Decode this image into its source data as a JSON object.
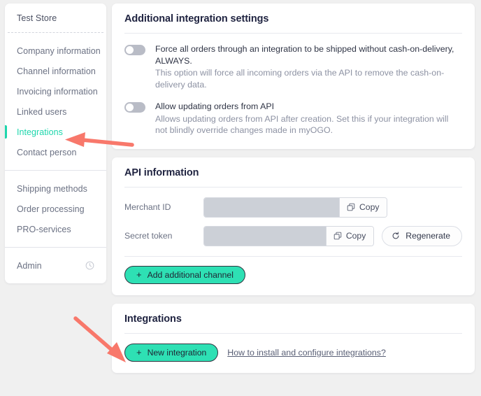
{
  "sidebar": {
    "store_name": "Test Store",
    "groups": [
      {
        "items": [
          {
            "label": "Company information",
            "active": false
          },
          {
            "label": "Channel information",
            "active": false
          },
          {
            "label": "Invoicing information",
            "active": false
          },
          {
            "label": "Linked users",
            "active": false
          },
          {
            "label": "Integrations",
            "active": true
          },
          {
            "label": "Contact person",
            "active": false
          }
        ]
      },
      {
        "items": [
          {
            "label": "Shipping methods",
            "active": false
          },
          {
            "label": "Order processing",
            "active": false
          },
          {
            "label": "PRO-services",
            "active": false
          }
        ]
      },
      {
        "items": [
          {
            "label": "Admin",
            "active": false,
            "icon": "clock-icon"
          }
        ]
      }
    ]
  },
  "settings_card": {
    "title": "Additional integration settings",
    "toggles": [
      {
        "state": "off",
        "label": "Force all orders through an integration to be shipped without cash-on-delivery, ALWAYS.",
        "description": "This option will force all incoming orders via the API to remove the cash-on-delivery data."
      },
      {
        "state": "off",
        "label": "Allow updating orders from API",
        "description": "Allows updating orders from API after creation. Set this if your integration will not blindly override changes made in myOGO."
      }
    ]
  },
  "api_card": {
    "title": "API information",
    "rows": [
      {
        "label": "Merchant ID",
        "value": "",
        "copy_label": "Copy",
        "copy_icon": "copy-icon",
        "has_regenerate": false
      },
      {
        "label": "Secret token",
        "value": "",
        "copy_label": "Copy",
        "copy_icon": "copy-icon",
        "has_regenerate": true,
        "regenerate_label": "Regenerate",
        "regenerate_icon": "refresh-icon"
      }
    ],
    "add_channel_label": "Add additional channel",
    "add_channel_plus": "+"
  },
  "integrations_card": {
    "title": "Integrations",
    "new_integration_label": "New integration",
    "new_integration_plus": "+",
    "help_link_label": "How to install and configure integrations?"
  },
  "annotations": {
    "arrow_color": "#f8786b",
    "arrows": [
      {
        "name": "arrow-to-integrations-nav",
        "direction": "left"
      },
      {
        "name": "arrow-to-new-integration-button",
        "direction": "down-right"
      }
    ]
  },
  "colors": {
    "accent": "#1ed6ac",
    "button": "#2ee0b4",
    "page_bg": "#f0f0f0",
    "heading": "#1f2340"
  }
}
